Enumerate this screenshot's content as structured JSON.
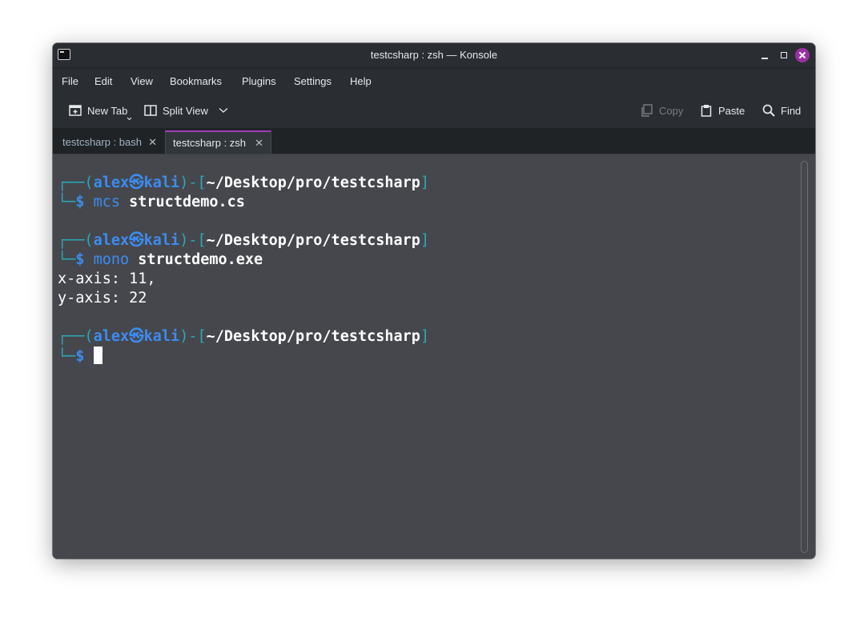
{
  "window": {
    "title": "testcsharp : zsh — Konsole"
  },
  "menu": {
    "items": [
      "File",
      "Edit",
      "View",
      "Bookmarks",
      "Plugins",
      "Settings",
      "Help"
    ]
  },
  "toolbar": {
    "new_tab": "New Tab",
    "split_view": "Split View",
    "copy": "Copy",
    "paste": "Paste",
    "find": "Find"
  },
  "tabs": [
    {
      "label": "testcsharp : bash",
      "active": false
    },
    {
      "label": "testcsharp : zsh",
      "active": true
    }
  ],
  "terminal": {
    "prompts": [
      {
        "user": "alex",
        "host": "kali",
        "path": "~/Desktop/pro/testcsharp",
        "command": "mcs",
        "arg": "structdemo.cs"
      },
      {
        "user": "alex",
        "host": "kali",
        "path": "~/Desktop/pro/testcsharp",
        "command": "mono",
        "arg": "structdemo.exe"
      },
      {
        "user": "alex",
        "host": "kali",
        "path": "~/Desktop/pro/testcsharp",
        "command": "",
        "arg": ""
      }
    ],
    "output": [
      "x-axis: 11,",
      "y-axis: 22"
    ],
    "prompt_symbol": "$"
  },
  "colors": {
    "accent": "#a33fb8",
    "prompt_teal": "#2ba9b4",
    "prompt_blue": "#3c8cf0",
    "terminal_bg": "#45474c"
  }
}
